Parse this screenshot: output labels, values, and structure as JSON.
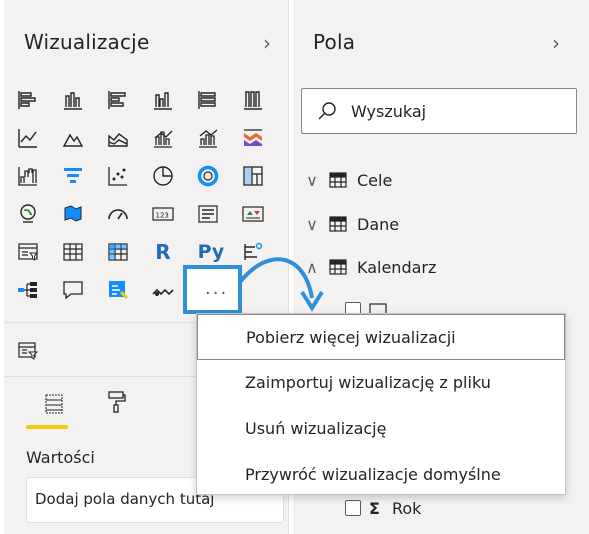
{
  "visualizations": {
    "title": "Wizualizacje",
    "expand_icon": "chevron-right",
    "more_label": "...",
    "wells_label": "Wartości",
    "well_placeholder": "Dodaj pola danych tutaj",
    "r_label": "R",
    "py_label": "Py"
  },
  "fields": {
    "title": "Pola",
    "expand_icon": "chevron-right",
    "search_placeholder": "Wyszukaj",
    "tables": [
      {
        "name": "Cele",
        "expanded": false
      },
      {
        "name": "Dane",
        "expanded": false
      },
      {
        "name": "Kalendarz",
        "expanded": true
      }
    ],
    "rok_label": "Rok",
    "sigma": "Σ"
  },
  "context_menu": {
    "items": [
      "Pobierz więcej wizualizacji",
      "Zaimportuj wizualizację z pliku",
      "Usuń wizualizację",
      "Przywróć wizualizacje domyślne"
    ]
  },
  "colors": {
    "accent_blue": "#2e90d9",
    "yellow": "#f2c811",
    "icon_dark": "#252423",
    "icon_teal": "#118dff"
  }
}
